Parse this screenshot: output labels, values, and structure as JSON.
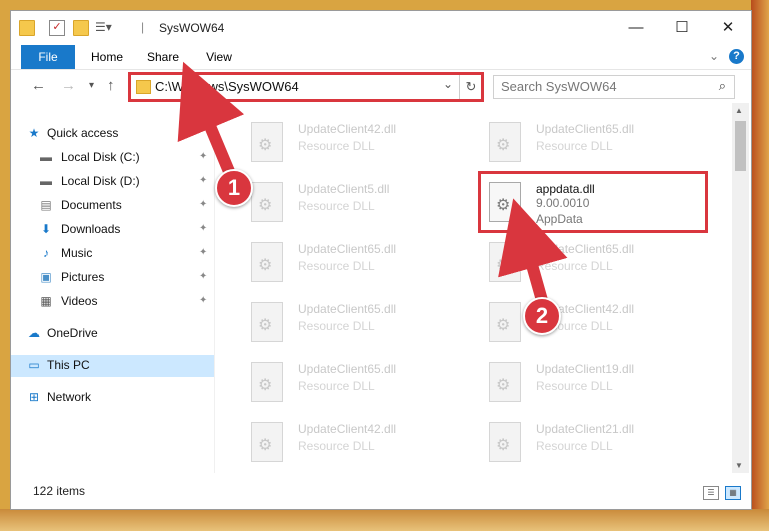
{
  "window": {
    "title": "SysWOW64",
    "controls": {
      "minimize": "—",
      "maximize": "☐",
      "close": "✕"
    }
  },
  "ribbon": {
    "tabs": [
      "File",
      "Home",
      "Share",
      "View"
    ],
    "expand_icon": "chevron-down-icon",
    "help_icon": "?"
  },
  "navigation": {
    "back_icon": "←",
    "forward_icon": "→",
    "recent_icon": "▾",
    "up_icon": "↑",
    "address": "C:\\Windows\\SysWOW64",
    "address_dropdown_icon": "⌄",
    "refresh_icon": "↻",
    "search_placeholder": "Search SysWOW64",
    "search_icon": "⌕"
  },
  "sidebar": {
    "items": [
      {
        "label": "Quick access",
        "icon": "★",
        "icon_name": "star-icon",
        "pinned": false
      },
      {
        "label": "Local Disk (C:)",
        "icon": "▬",
        "icon_name": "drive-icon",
        "pinned": true
      },
      {
        "label": "Local Disk (D:)",
        "icon": "▬",
        "icon_name": "drive-icon",
        "pinned": true
      },
      {
        "label": "Documents",
        "icon": "▤",
        "icon_name": "documents-icon",
        "pinned": true
      },
      {
        "label": "Downloads",
        "icon": "⬇",
        "icon_name": "download-icon",
        "pinned": true
      },
      {
        "label": "Music",
        "icon": "♪",
        "icon_name": "music-icon",
        "pinned": true
      },
      {
        "label": "Pictures",
        "icon": "▣",
        "icon_name": "pictures-icon",
        "pinned": true
      },
      {
        "label": "Videos",
        "icon": "▦",
        "icon_name": "videos-icon",
        "pinned": true
      },
      {
        "label": "OneDrive",
        "icon": "☁",
        "icon_name": "cloud-icon",
        "pinned": false
      },
      {
        "label": "This PC",
        "icon": "▭",
        "icon_name": "computer-icon",
        "pinned": false,
        "selected": true
      },
      {
        "label": "Network",
        "icon": "⊞",
        "icon_name": "network-icon",
        "pinned": false
      }
    ],
    "pin_icon": "📌"
  },
  "files": {
    "left_column": [
      {
        "name": "UpdateClient42.dll",
        "type": "Resource DLL"
      },
      {
        "name": "UpdateClient5.dll",
        "type": "Resource DLL"
      },
      {
        "name": "UpdateClient65.dll",
        "type": "Resource DLL"
      },
      {
        "name": "UpdateClient65.dll",
        "type": "Resource DLL"
      },
      {
        "name": "UpdateClient65.dll",
        "type": "Resource DLL"
      },
      {
        "name": "UpdateClient42.dll",
        "type": "Resource DLL"
      }
    ],
    "right_column": [
      {
        "name": "UpdateClient65.dll",
        "type": "Resource DLL"
      },
      {
        "name": "appdata.dll",
        "version": "9.00.0010",
        "type": "AppData",
        "highlighted": true
      },
      {
        "name": "UpdateClient65.dll",
        "type": "Resource DLL"
      },
      {
        "name": "UpdateClient42.dll",
        "type": "Resource DLL"
      },
      {
        "name": "UpdateClient19.dll",
        "type": "Resource DLL"
      },
      {
        "name": "UpdateClient21.dll",
        "type": "Resource DLL"
      }
    ]
  },
  "status": {
    "item_count": "122 items"
  },
  "annotations": {
    "step1": "1",
    "step2": "2",
    "color": "#d9363e"
  }
}
